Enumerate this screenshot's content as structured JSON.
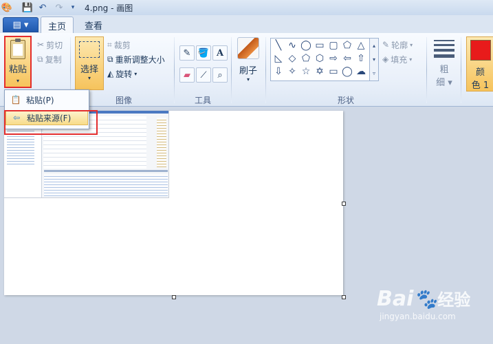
{
  "window": {
    "title": "4.png - 画图"
  },
  "quick_access": {
    "icons": [
      "app-icon",
      "save-icon",
      "undo-icon",
      "redo-icon",
      "customize-icon"
    ]
  },
  "tabs": {
    "home": "主页",
    "view": "查看"
  },
  "clipboard": {
    "paste": "粘贴",
    "cut": "剪切",
    "copy": "复制",
    "dropdown": {
      "paste_item": "粘贴(P)",
      "paste_from_item": "粘贴来源(F)"
    }
  },
  "image": {
    "select": "选择",
    "crop": "裁剪",
    "resize": "重新调整大小",
    "rotate": "旋转",
    "group_label": "图像"
  },
  "tools": {
    "group_label": "工具"
  },
  "brushes": {
    "label": "刷子"
  },
  "shapes": {
    "outline": "轮廓",
    "fill": "填充",
    "group_label": "形状"
  },
  "size": {
    "label_top": "粗",
    "label_bottom": "细"
  },
  "colors": {
    "color1_top": "颜",
    "color1_bottom": "色 1",
    "current_color": "#e81b1b"
  },
  "watermark": {
    "brand": "Bai",
    "brand2": "经验",
    "url": "jingyan.baidu.com"
  }
}
